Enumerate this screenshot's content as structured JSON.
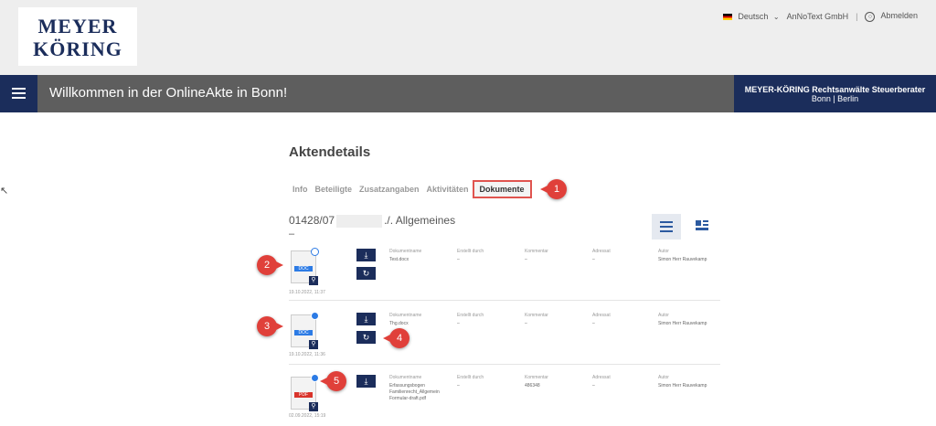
{
  "header": {
    "logo_line1": "MEYER",
    "logo_line2": "KÖRING",
    "language": "Deutsch",
    "org": "AnNoText GmbH",
    "separator": "|",
    "logout": "Abmelden"
  },
  "navbar": {
    "welcome": "Willkommen in der OnlineAkte in Bonn!",
    "firm_line1": "MEYER-KÖRING Rechtsanwälte Steuerberater",
    "firm_line2": "Bonn | Berlin"
  },
  "main": {
    "title": "Aktendetails",
    "tabs": [
      "Info",
      "Beteiligte",
      "Zusatzangaben",
      "Aktivitäten",
      "Dokumente"
    ],
    "case_prefix": "01428/07",
    "case_suffix": "./. Allgemeines",
    "case_dash": "–"
  },
  "columns": {
    "name": "Dokumentname",
    "created": "Erstellt durch",
    "comment": "Kommentar",
    "addressee": "Adressat",
    "author": "Autor"
  },
  "documents": [
    {
      "type": "DOC",
      "date": "19.10.2022, 11:37",
      "name": "Test.docx",
      "created": "–",
      "comment": "–",
      "addressee": "–",
      "author": "Simon Herr Rauvekamp"
    },
    {
      "type": "DOC",
      "date": "19.10.2022, 11:36",
      "name": "Thg.docx",
      "created": "–",
      "comment": "–",
      "addressee": "–",
      "author": "Simon Herr Rauvekamp"
    },
    {
      "type": "PDF",
      "date": "02.09.2022, 15:19",
      "name": "Erfassungsbogen Familienrecht_Allgemein Formular-draft.pdf",
      "created": "–",
      "comment": "486348",
      "addressee": "–",
      "author": "Simon Herr Rauvekamp"
    }
  ],
  "callouts": [
    "1",
    "2",
    "3",
    "4",
    "5"
  ],
  "colors": {
    "navy": "#1b2d5b",
    "callout": "#e0403a",
    "navbar": "#5e5e5e",
    "doc_tag": "#2c7be5",
    "pdf_tag": "#d9342b"
  }
}
